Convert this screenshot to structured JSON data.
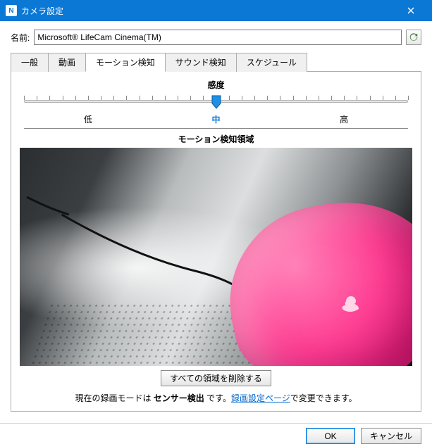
{
  "window": {
    "title": "カメラ設定",
    "icon_label": "N"
  },
  "name_row": {
    "label": "名前:",
    "value": "Microsoft® LifeCam Cinema(TM)"
  },
  "tabs": {
    "items": [
      {
        "label": "一般"
      },
      {
        "label": "動画"
      },
      {
        "label": "モーション検知"
      },
      {
        "label": "サウンド検知"
      },
      {
        "label": "スケジュール"
      }
    ],
    "active_index": 2
  },
  "sensitivity": {
    "title": "感度",
    "low": "低",
    "mid": "中",
    "high": "高",
    "value_percent": 50
  },
  "region": {
    "title": "モーション検知領域",
    "clear_button": "すべての領域を削除する"
  },
  "note": {
    "prefix": "現在の録画モードは ",
    "mode_bold": "センサー検出",
    "between": " です。",
    "link": "録画設定ページ",
    "suffix": "で変更できます。"
  },
  "footer": {
    "ok": "OK",
    "cancel": "キャンセル"
  }
}
